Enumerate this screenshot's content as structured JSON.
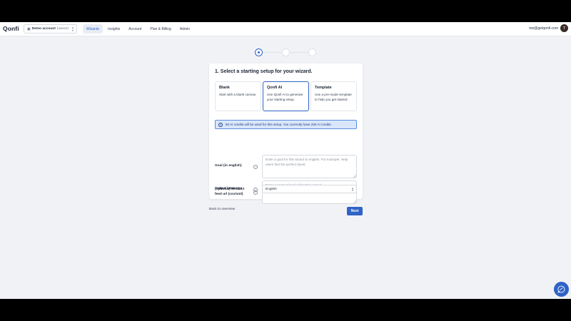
{
  "header": {
    "logo": "Qonfi",
    "account": {
      "name": "Demo account",
      "role": "(owner)"
    },
    "nav": [
      {
        "label": "Wizards",
        "active": true
      },
      {
        "label": "Insights",
        "active": false
      },
      {
        "label": "Account",
        "active": false
      },
      {
        "label": "Plan & Billing",
        "active": false
      },
      {
        "label": "Admin",
        "active": false
      }
    ],
    "user_email": "ton@getqonfi.com",
    "avatar_initial": "T"
  },
  "stepper": {
    "total": 3,
    "current": 1
  },
  "card": {
    "title": "1. Select a starting setup for your wizard.",
    "options": [
      {
        "title": "Blank",
        "description": "Start with a blank canvas.",
        "selected": false
      },
      {
        "title": "Qonfi AI",
        "description": "Use Qonfi AI to generate your starting setup.",
        "selected": true
      },
      {
        "title": "Template",
        "description": "Use a pre-made template to help you get started.",
        "selected": false
      }
    ],
    "info_banner": "50 AI credits will be used for this setup. You currently have 200 AI credits.",
    "fields": {
      "goal": {
        "label": "Goal (in english)",
        "value": "",
        "placeholder": "Enter a goal for this wizard in english. For example: Help users find the perfect duvet."
      },
      "feed": {
        "label": "(optional) Product feed url (csv/xml)",
        "value": "",
        "placeholder": "Enter a product feed url for this wizard."
      },
      "language": {
        "label": "Output language",
        "value": "English"
      }
    }
  },
  "footer": {
    "back_label": "Back to overview",
    "next_label": "Next"
  },
  "colors": {
    "accent": "#2f63c7",
    "banner_bg": "#d9e6fb",
    "page_bg": "#f1f2f5"
  },
  "icons": {
    "chat": "chat-bubble-icon",
    "info": "info-icon",
    "help": "help-circle-icon"
  }
}
